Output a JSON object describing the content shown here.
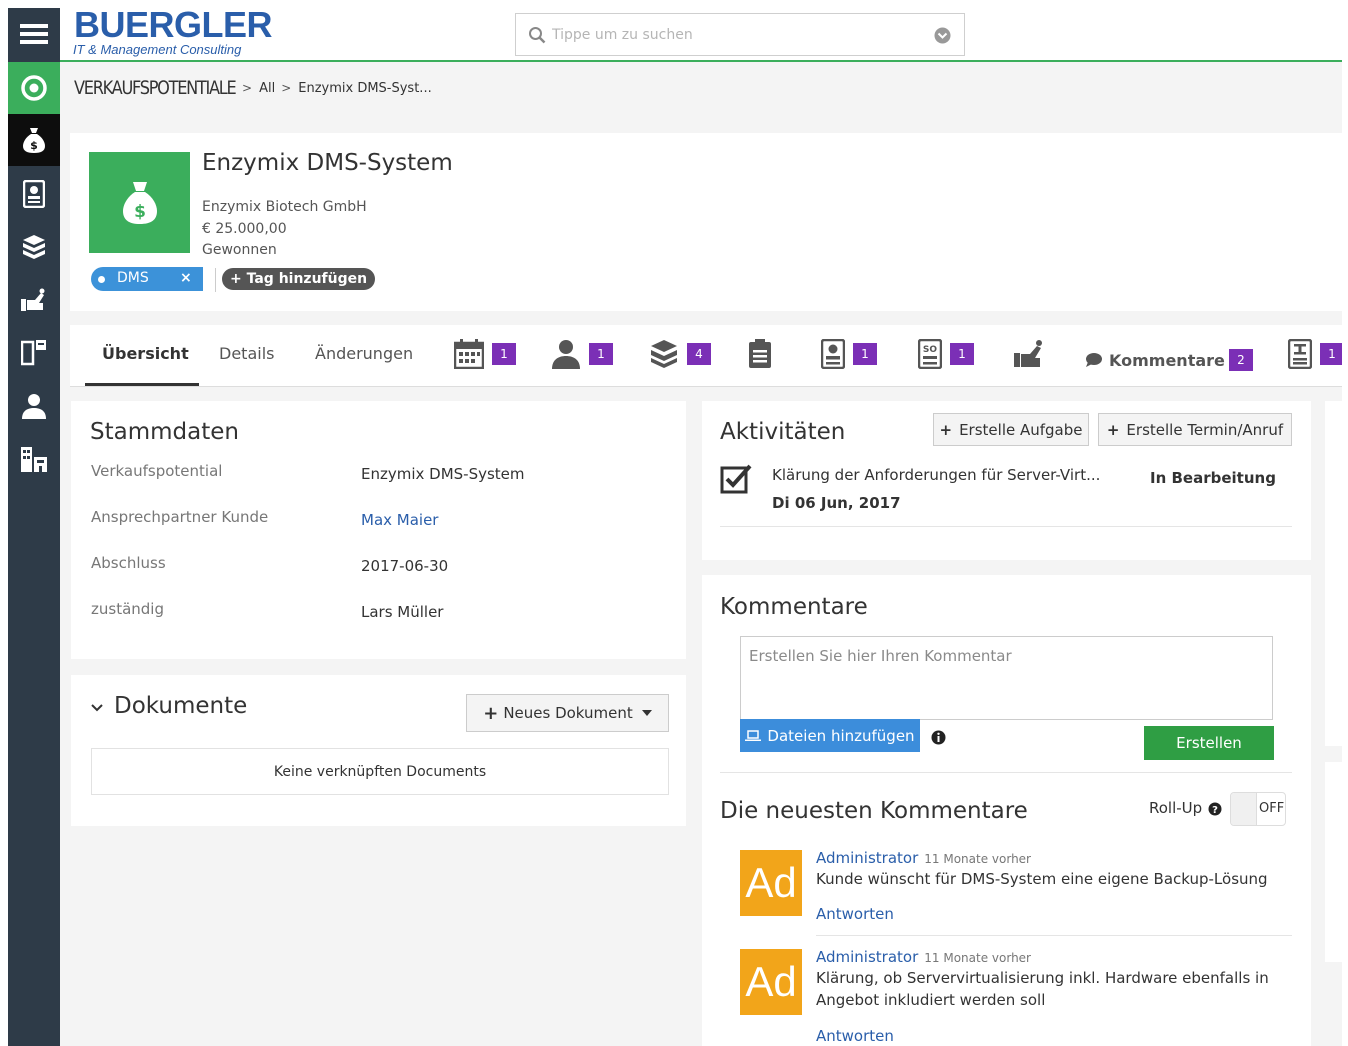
{
  "header": {
    "logo_title": "BUERGLER",
    "logo_subtitle": "IT & Management Consulting",
    "search_placeholder": "Tippe um zu suchen"
  },
  "sidebar": {
    "icons": [
      "menu-icon",
      "target-icon",
      "money-bag-icon",
      "contact-card-icon",
      "cubes-icon",
      "handshake-icon",
      "kanban-icon",
      "person-icon",
      "buildings-icon"
    ]
  },
  "breadcrumb": {
    "root": "VERKAUFSPOTENTIALE",
    "level1": "All",
    "level2": "Enzymix DMS-Syst..."
  },
  "opportunity": {
    "title": "Enzymix DMS-System",
    "company": "Enzymix Biotech GmbH",
    "amount": "€ 25.000,00",
    "status": "Gewonnen",
    "tag": "DMS",
    "tag_remove": "×",
    "add_tag": "+ Tag hinzufügen"
  },
  "tabs": {
    "overview": "Übersicht",
    "details": "Details",
    "changes": "Änderungen",
    "calendar_count": "1",
    "persons_count": "1",
    "products_count": "4",
    "quotes_count": "1",
    "salesorders_count": "1",
    "comments_label": "Kommentare",
    "comments_count": "2",
    "invoices_count": "1"
  },
  "stammdaten": {
    "title": "Stammdaten",
    "rows": [
      {
        "label": "Verkaufspotential",
        "value": "Enzymix DMS-System"
      },
      {
        "label": "Ansprechpartner Kunde",
        "value": "Max Maier"
      },
      {
        "label": "Abschluss",
        "value": "2017-06-30"
      },
      {
        "label": "zuständig",
        "value": "Lars Müller"
      }
    ]
  },
  "dokumente": {
    "title": "Dokumente",
    "new_button": "Neues Dokument",
    "empty": "Keine verknüpften Documents"
  },
  "aktivitaeten": {
    "title": "Aktivitäten",
    "create_task": "Erstelle Aufgabe",
    "create_event": "Erstelle Termin/Anruf",
    "item_text": "Klärung der Anforderungen für Server-Virt...",
    "item_date": "Di 06 Jun, 2017",
    "item_status": "In Bearbeitung"
  },
  "kommentare": {
    "title": "Kommentare",
    "placeholder": "Erstellen Sie hier Ihren Kommentar",
    "add_files": "Dateien hinzufügen",
    "create": "Erstellen",
    "latest_title": "Die neuesten Kommentare",
    "rollup_label": "Roll-Up",
    "toggle_state": "OFF",
    "items": [
      {
        "avatar": "Ad",
        "author": "Administrator",
        "time": "11 Monate vorher",
        "text": "Kunde wünscht für DMS-System eine eigene Backup-Lösung",
        "reply": "Antworten"
      },
      {
        "avatar": "Ad",
        "author": "Administrator",
        "time": "11 Monate vorher",
        "text": "Klärung, ob Servervirtualisierung inkl. Hardware ebenfalls in Angebot inkludiert werden soll",
        "reply": "Antworten"
      }
    ]
  },
  "colors": {
    "sidebar": "#2e3b48",
    "accent_green": "#3bae5c",
    "brand_blue": "#2a5eaa",
    "badge_purple": "#7b2fb6",
    "avatar_orange": "#f2a51a"
  }
}
